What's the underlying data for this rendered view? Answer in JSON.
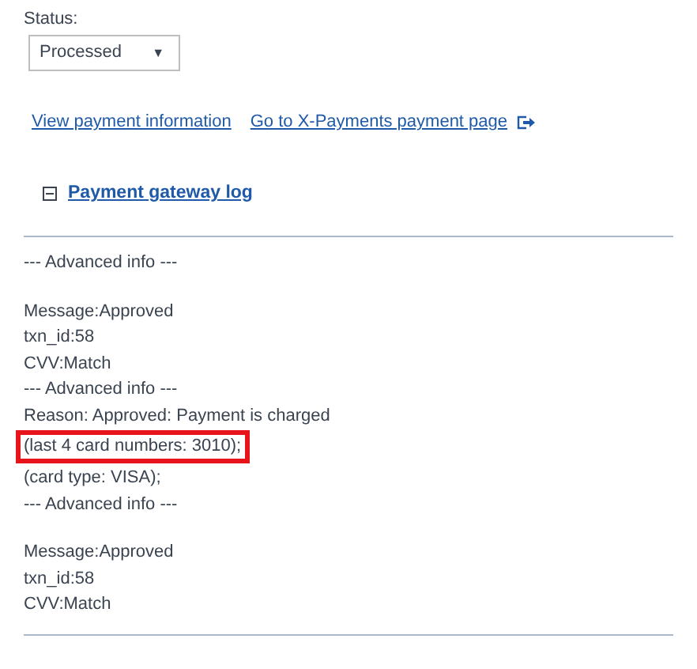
{
  "status": {
    "label": "Status:",
    "value": "Processed",
    "arrow": "▼"
  },
  "links": [
    {
      "text": "View payment information",
      "external": false
    },
    {
      "text": "Go to X-Payments payment page",
      "external": true
    }
  ],
  "gateway_log": {
    "title": "Payment gateway log",
    "expanded": true,
    "lines": [
      {
        "text": "--- Advanced info ---",
        "gap_before": false,
        "highlighted": false
      },
      {
        "text": "Message:Approved",
        "gap_before": true,
        "highlighted": false
      },
      {
        "text": "txn_id:58",
        "gap_before": false,
        "highlighted": false
      },
      {
        "text": "CVV:Match",
        "gap_before": false,
        "highlighted": false
      },
      {
        "text": "--- Advanced info ---",
        "gap_before": false,
        "highlighted": false
      },
      {
        "text": "Reason: Approved: Payment is charged",
        "gap_before": false,
        "highlighted": false
      },
      {
        "text": "(last 4 card numbers: 3010);",
        "gap_before": false,
        "highlighted": true
      },
      {
        "text": "(card type: VISA);",
        "gap_before": false,
        "highlighted": false
      },
      {
        "text": "--- Advanced info ---",
        "gap_before": false,
        "highlighted": false
      },
      {
        "text": "Message:Approved",
        "gap_before": true,
        "highlighted": false
      },
      {
        "text": "txn_id:58",
        "gap_before": false,
        "highlighted": false
      },
      {
        "text": "CVV:Match",
        "gap_before": false,
        "highlighted": false
      }
    ]
  }
}
